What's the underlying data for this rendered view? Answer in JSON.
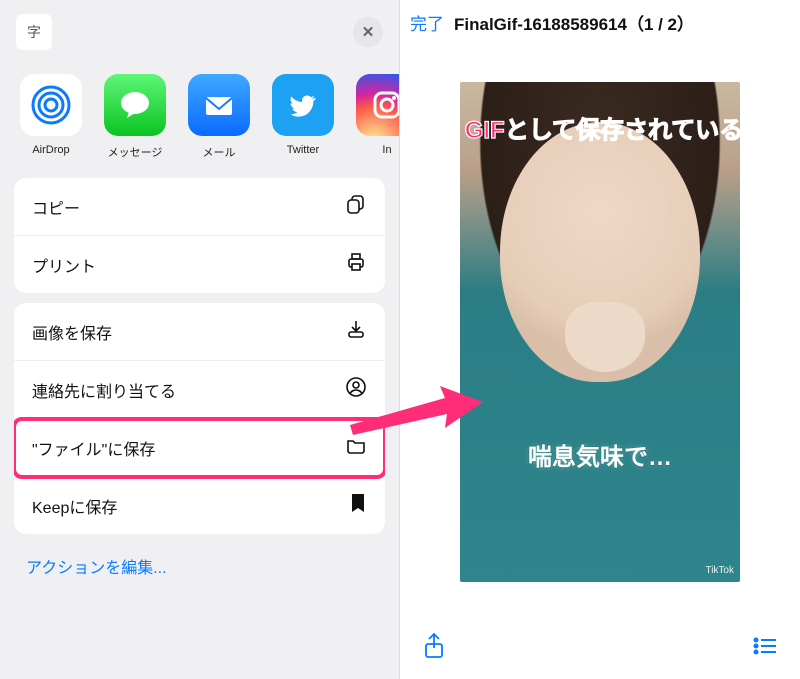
{
  "left": {
    "title_glyph": "字",
    "apps": [
      {
        "name": "airdrop",
        "label": "AirDrop"
      },
      {
        "name": "messages",
        "label": "メッセージ"
      },
      {
        "name": "mail",
        "label": "メール"
      },
      {
        "name": "twitter",
        "label": "Twitter"
      },
      {
        "name": "instagram",
        "label": "In"
      }
    ],
    "group1": [
      {
        "name": "copy",
        "label": "コピー",
        "icon": "copy"
      },
      {
        "name": "print",
        "label": "プリント",
        "icon": "print"
      }
    ],
    "group2": [
      {
        "name": "save-image",
        "label": "画像を保存",
        "icon": "download"
      },
      {
        "name": "assign-contact",
        "label": "連絡先に割り当てる",
        "icon": "contact"
      },
      {
        "name": "save-files",
        "label": "\"ファイル\"に保存",
        "icon": "folder",
        "highlight": true
      },
      {
        "name": "save-keep",
        "label": "Keepに保存",
        "icon": "bookmark"
      }
    ],
    "edit_label": "アクションを編集..."
  },
  "right": {
    "done_label": "完了",
    "file_title": "FinalGif-16188589614（1 / 2）",
    "gif_subtitle": "喘息気味で…",
    "watermark": "TikTok"
  },
  "overlay": {
    "banner": "GIFとして保存されている"
  }
}
